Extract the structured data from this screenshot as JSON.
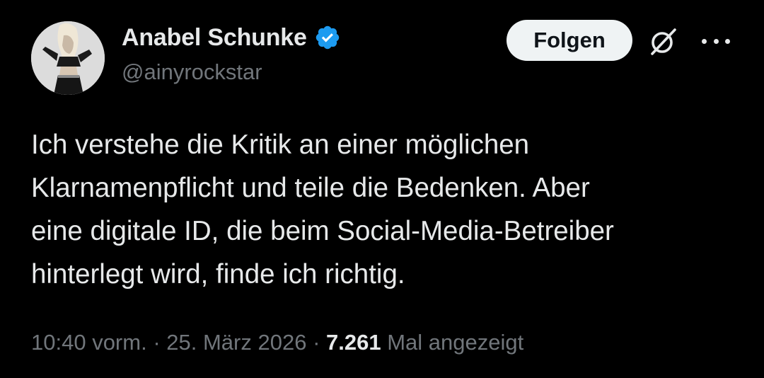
{
  "author": {
    "display_name": "Anabel Schunke",
    "handle": "@ainyrockstar",
    "verified_icon": "verified-badge-icon",
    "verified_color": "#1d9bf0"
  },
  "actions": {
    "follow_label": "Folgen",
    "grok_icon": "grok-icon",
    "more_icon": "more-horizontal-icon"
  },
  "tweet": {
    "text_lines": [
      "Ich verstehe die Kritik an einer möglichen",
      "Klarnamenpflicht und teile die Bedenken. Aber",
      "eine digitale ID, die beim Social-Media-Betreiber",
      "hinterlegt wird, finde ich richtig."
    ]
  },
  "meta": {
    "time": "10:40 vorm.",
    "separator": "·",
    "date": "25. März 2026",
    "views_count": "7.261",
    "views_label": "Mal angezeigt"
  },
  "colors": {
    "background": "#000000",
    "primary_text": "#e7e9ea",
    "secondary_text": "#71767b",
    "button_bg": "#eff3f4",
    "button_text": "#0f1419"
  }
}
